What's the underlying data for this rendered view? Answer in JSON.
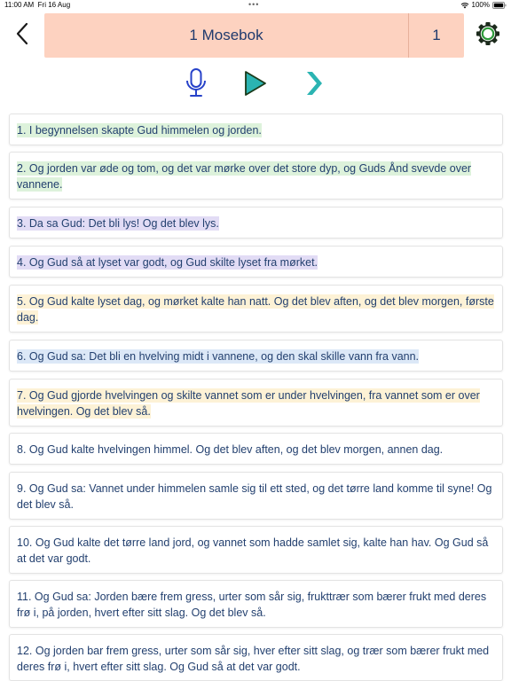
{
  "status_bar": {
    "time": "11:00 AM",
    "date": "Fri 16 Aug",
    "battery": "100%"
  },
  "header": {
    "book_title": "1 Mosebok",
    "chapter": "1"
  },
  "colors": {
    "header_bg": "#fdd2c0",
    "accent_blue": "#2742c9",
    "play_teal": "#2bb4b2",
    "text": "#23406f",
    "highlight_green": "#ddf2db",
    "highlight_purple": "#e2dcf5",
    "highlight_yellow": "#fdf2d6",
    "highlight_blue": "#dce8f7"
  },
  "icons": {
    "back": "chevron-left-icon",
    "settings": "gear-icon",
    "microphone": "microphone-icon",
    "play": "play-icon",
    "next": "chevron-right-icon"
  },
  "verses": [
    {
      "text": "1. I begynnelsen skapte Gud himmelen og jorden.",
      "highlight": "green"
    },
    {
      "text": "2. Og jorden var øde og tom, og det var mørke over det store dyp, og Guds Ånd svevde over vannene.",
      "highlight": "green"
    },
    {
      "text": "3. Da sa Gud: Det bli lys! Og det blev lys.",
      "highlight": "purple"
    },
    {
      "text": "4. Og Gud så at lyset var godt, og Gud skilte lyset fra mørket.",
      "highlight": "purple"
    },
    {
      "text": "5. Og Gud kalte lyset dag, og mørket kalte han natt. Og det blev aften, og det blev morgen, første dag.",
      "highlight": "yellow"
    },
    {
      "text": "6. Og Gud sa: Det bli en hvelving midt i vannene, og den skal skille vann fra vann.",
      "highlight": "blue"
    },
    {
      "text": "7. Og Gud gjorde hvelvingen og skilte vannet som er under hvelvingen, fra vannet som er over hvelvingen. Og det blev så.",
      "highlight": "yellow"
    },
    {
      "text": "8. Og Gud kalte hvelvingen himmel. Og det blev aften, og det blev morgen, annen dag.",
      "highlight": "none"
    },
    {
      "text": "9. Og Gud sa: Vannet under himmelen samle sig til ett sted, og det tørre land komme til syne! Og det blev så.",
      "highlight": "none"
    },
    {
      "text": "10. Og Gud kalte det tørre land jord, og vannet som hadde samlet sig, kalte han hav. Og Gud så at det var godt.",
      "highlight": "none"
    },
    {
      "text": "11. Og Gud sa: Jorden bære frem gress, urter som sår sig, frukttrær som bærer frukt med deres frø i, på jorden, hvert efter sitt slag. Og det blev så.",
      "highlight": "none"
    },
    {
      "text": "12. Og jorden bar frem gress, urter som sår sig, hver efter sitt slag, og trær som bærer frukt med deres frø i, hvert efter sitt slag. Og Gud så at det var godt.",
      "highlight": "none"
    }
  ]
}
